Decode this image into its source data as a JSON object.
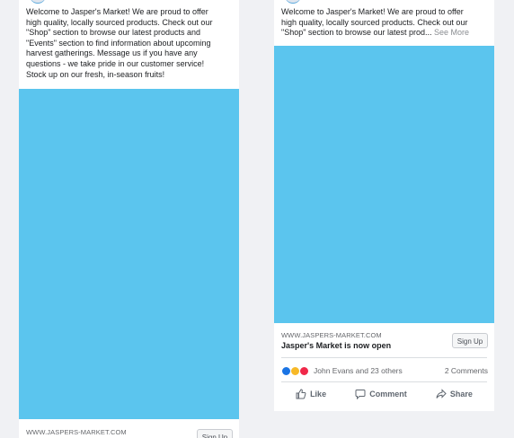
{
  "left_post": {
    "text": "Welcome to Jasper's Market! We are proud to offer\nhigh quality, locally sourced products. Check out our\n\"Shop\" section to browse our latest products and\n\"Events\" section to find information about upcoming\nharvest gatherings. Message us if you have any\nquestions - we take pride in our customer service!\nStock up on our fresh, in-season fruits!",
    "link_url": "WWW.JASPERS-MARKET.COM",
    "cta_label": "Sign Up"
  },
  "right_post": {
    "text": "Welcome to Jasper's Market! We are proud to offer\nhigh quality, locally sourced products. Check out our\n\"Shop\" section to browse our latest prod...",
    "see_more": "See More",
    "link_url": "WWW.JASPERS-MARKET.COM",
    "link_title": "Jasper's Market is now open",
    "cta_label": "Sign Up",
    "reactions_text": "John Evans and 23 others",
    "comments_count": "2 Comments",
    "actions": {
      "like": "Like",
      "comment": "Comment",
      "share": "Share"
    },
    "reaction_icons": [
      "like-reaction-icon",
      "wow-reaction-icon",
      "love-reaction-icon"
    ]
  },
  "colors": {
    "media_blue": "#5bc5ee",
    "background": "#f0f1f4",
    "like_blue": "#1b74e4",
    "wow_yellow": "#f7b928",
    "love_red": "#f02849"
  }
}
